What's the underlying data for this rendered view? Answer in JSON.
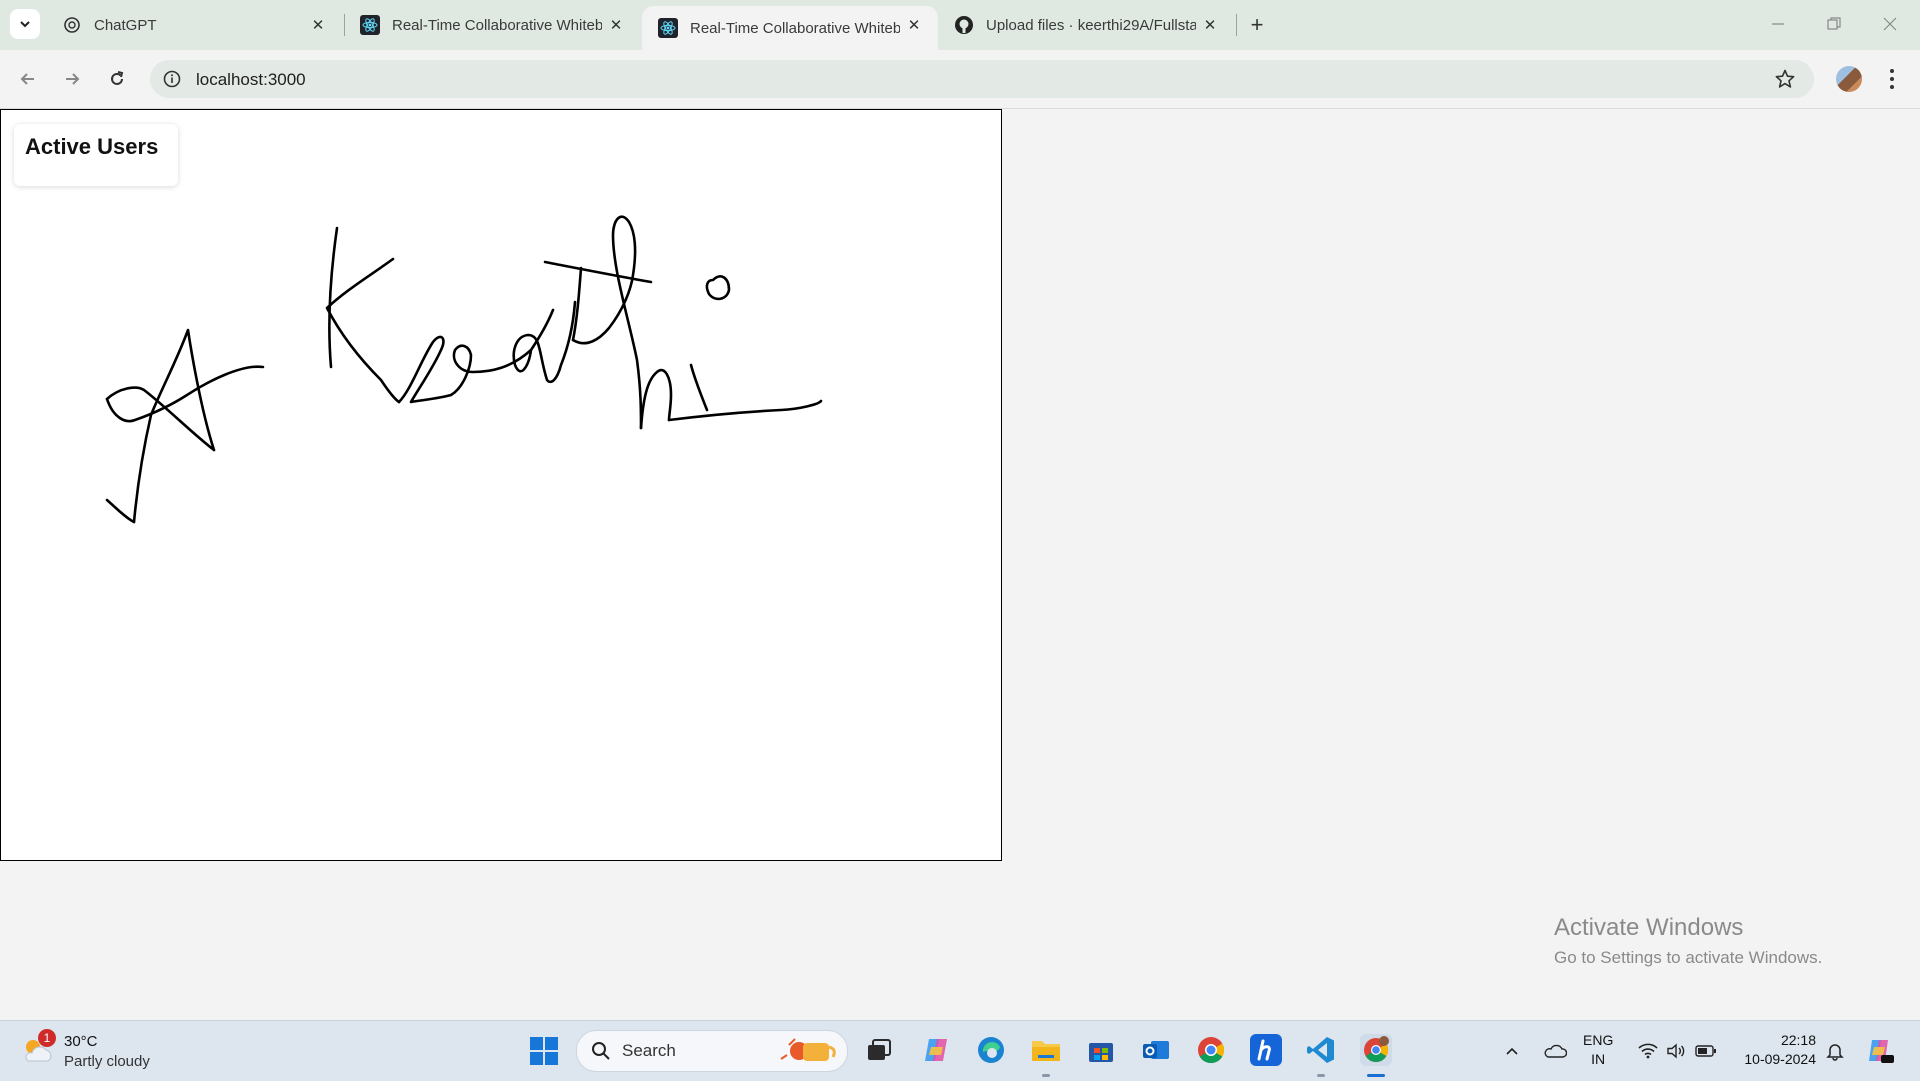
{
  "browser": {
    "tabs": [
      {
        "title": "ChatGPT",
        "icon": "chatgpt-icon",
        "active": false
      },
      {
        "title": "Real-Time Collaborative Whiteb",
        "icon": "react-icon",
        "active": false
      },
      {
        "title": "Real-Time Collaborative Whiteb",
        "icon": "react-icon",
        "active": true
      },
      {
        "title": "Upload files · keerthi29A/Fullsta",
        "icon": "github-icon",
        "active": false
      }
    ],
    "address": "localhost:3000"
  },
  "page": {
    "active_users_heading": "Active Users",
    "drawing_description": "freehand signature strokes"
  },
  "watermark": {
    "line1": "Activate Windows",
    "line2": "Go to Settings to activate Windows."
  },
  "taskbar": {
    "weather": {
      "temp": "30°C",
      "condition": "Partly cloudy",
      "badge": "1"
    },
    "search_label": "Search",
    "language": {
      "line1": "ENG",
      "line2": "IN"
    },
    "clock": {
      "time": "22:18",
      "date": "10-09-2024"
    }
  }
}
